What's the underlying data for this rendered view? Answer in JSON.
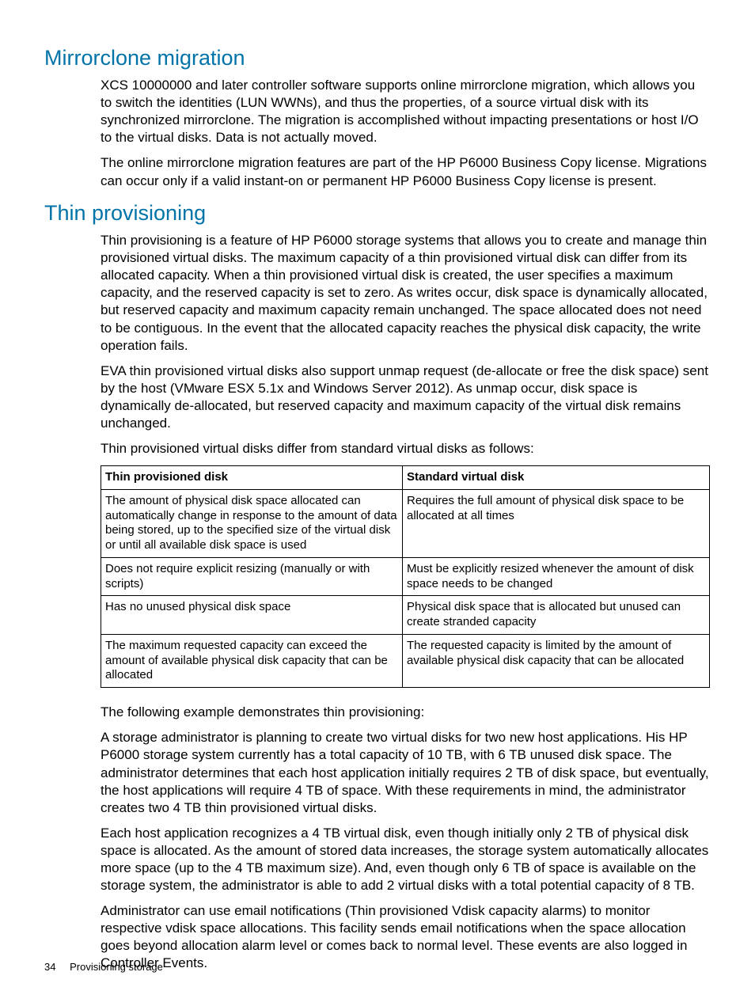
{
  "section1": {
    "heading": "Mirrorclone migration",
    "p1": "XCS 10000000 and later controller software supports online mirrorclone migration, which allows you to switch the identities (LUN WWNs), and thus the properties, of a source virtual disk with its synchronized mirrorclone. The migration is accomplished without impacting presentations or host I/O to the virtual disks. Data is not actually moved.",
    "p2": "The online mirrorclone migration features are part of the HP P6000 Business Copy license. Migrations can occur only if a valid instant-on or permanent HP P6000 Business Copy license is present."
  },
  "section2": {
    "heading": "Thin provisioning",
    "p1": "Thin provisioning is a feature of HP P6000 storage systems that allows you to create and manage thin provisioned virtual disks. The maximum capacity of a thin provisioned virtual disk can differ from its allocated capacity. When a thin provisioned virtual disk is created, the user specifies a maximum capacity, and the reserved capacity is set to zero. As writes occur, disk space is dynamically allocated, but reserved capacity and maximum capacity remain unchanged. The space allocated does not need to be contiguous. In the event that the allocated capacity reaches the physical disk capacity, the write operation fails.",
    "p2": "EVA thin provisioned virtual disks also support unmap request (de-allocate or free the disk space) sent by the host (VMware ESX 5.1x and Windows Server 2012). As unmap occur, disk space is dynamically de-allocated, but reserved capacity and maximum capacity of the virtual disk remains unchanged.",
    "p3": "Thin provisioned virtual disks differ from standard virtual disks as follows:",
    "p4": "The following example demonstrates thin provisioning:",
    "p5": "A storage administrator is planning to create two virtual disks for two new host applications. His HP P6000 storage system currently has a total capacity of 10 TB, with 6 TB unused disk space. The administrator determines that each host application initially requires 2 TB of disk space, but eventually, the host applications will require 4 TB of space. With these requirements in mind, the administrator creates two 4 TB thin provisioned virtual disks.",
    "p6": "Each host application recognizes a 4 TB virtual disk, even though initially only 2 TB of physical disk space is allocated. As the amount of stored data increases, the storage system automatically allocates more space (up to the 4 TB maximum size). And, even though only 6 TB of space is available on the storage system, the administrator is able to add 2 virtual disks with a total potential capacity of 8 TB.",
    "p7": "Administrator can use email notifications (Thin provisioned Vdisk capacity alarms) to monitor respective vdisk space allocations. This facility sends email notifications when the space allocation goes beyond allocation alarm level or comes back to normal level. These events are also logged in Controller Events."
  },
  "table": {
    "h1": "Thin provisioned disk",
    "h2": "Standard virtual disk",
    "r1c1": "The amount of physical disk space allocated can automatically change in response to the amount of data being stored, up to the specified size of the virtual disk or until all available disk space is used",
    "r1c2": "Requires the full amount of physical disk space to be allocated at all times",
    "r2c1": "Does not require explicit resizing (manually or with scripts)",
    "r2c2": "Must be explicitly resized whenever the amount of disk space needs to be changed",
    "r3c1": "Has no unused physical disk space",
    "r3c2": "Physical disk space that is allocated but unused can create stranded capacity",
    "r4c1": "The maximum requested capacity can exceed the amount of available physical disk capacity that can be allocated",
    "r4c2": "The requested capacity is limited by the amount of available physical disk capacity that can be allocated"
  },
  "footer": {
    "page_number": "34",
    "section_name": "Provisioning storage"
  }
}
